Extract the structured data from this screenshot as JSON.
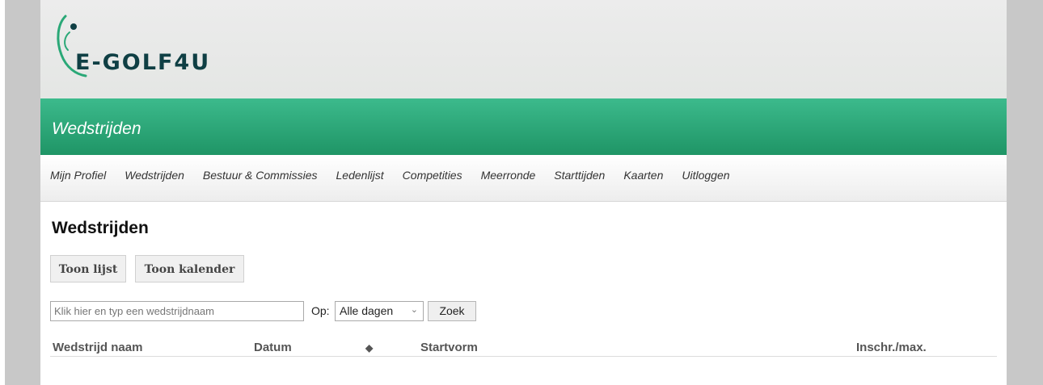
{
  "brand": {
    "logo_text": "E-GOLF4U",
    "accent_color": "#2aa877",
    "logo_color": "#0f3f44"
  },
  "header": {
    "section_title": "Wedstrijden"
  },
  "nav": {
    "items": [
      {
        "label": "Mijn Profiel"
      },
      {
        "label": "Wedstrijden"
      },
      {
        "label": "Bestuur & Commissies"
      },
      {
        "label": "Ledenlijst"
      },
      {
        "label": "Competities"
      },
      {
        "label": "Meerronde"
      },
      {
        "label": "Starttijden"
      },
      {
        "label": "Kaarten"
      },
      {
        "label": "Uitloggen"
      }
    ]
  },
  "main": {
    "title": "Wedstrijden",
    "view_buttons": {
      "list": "Toon lijst",
      "calendar": "Toon kalender"
    },
    "search": {
      "placeholder": "Klik hier en typ een wedstrijdnaam",
      "value": "",
      "op_label": "Op:",
      "day_filter": "Alle dagen",
      "submit": "Zoek"
    },
    "table": {
      "columns": [
        "Wedstrijd naam",
        "Datum",
        "Startvorm",
        "Inschr./max."
      ],
      "sort_icon": "sort-icon",
      "rows": []
    }
  }
}
